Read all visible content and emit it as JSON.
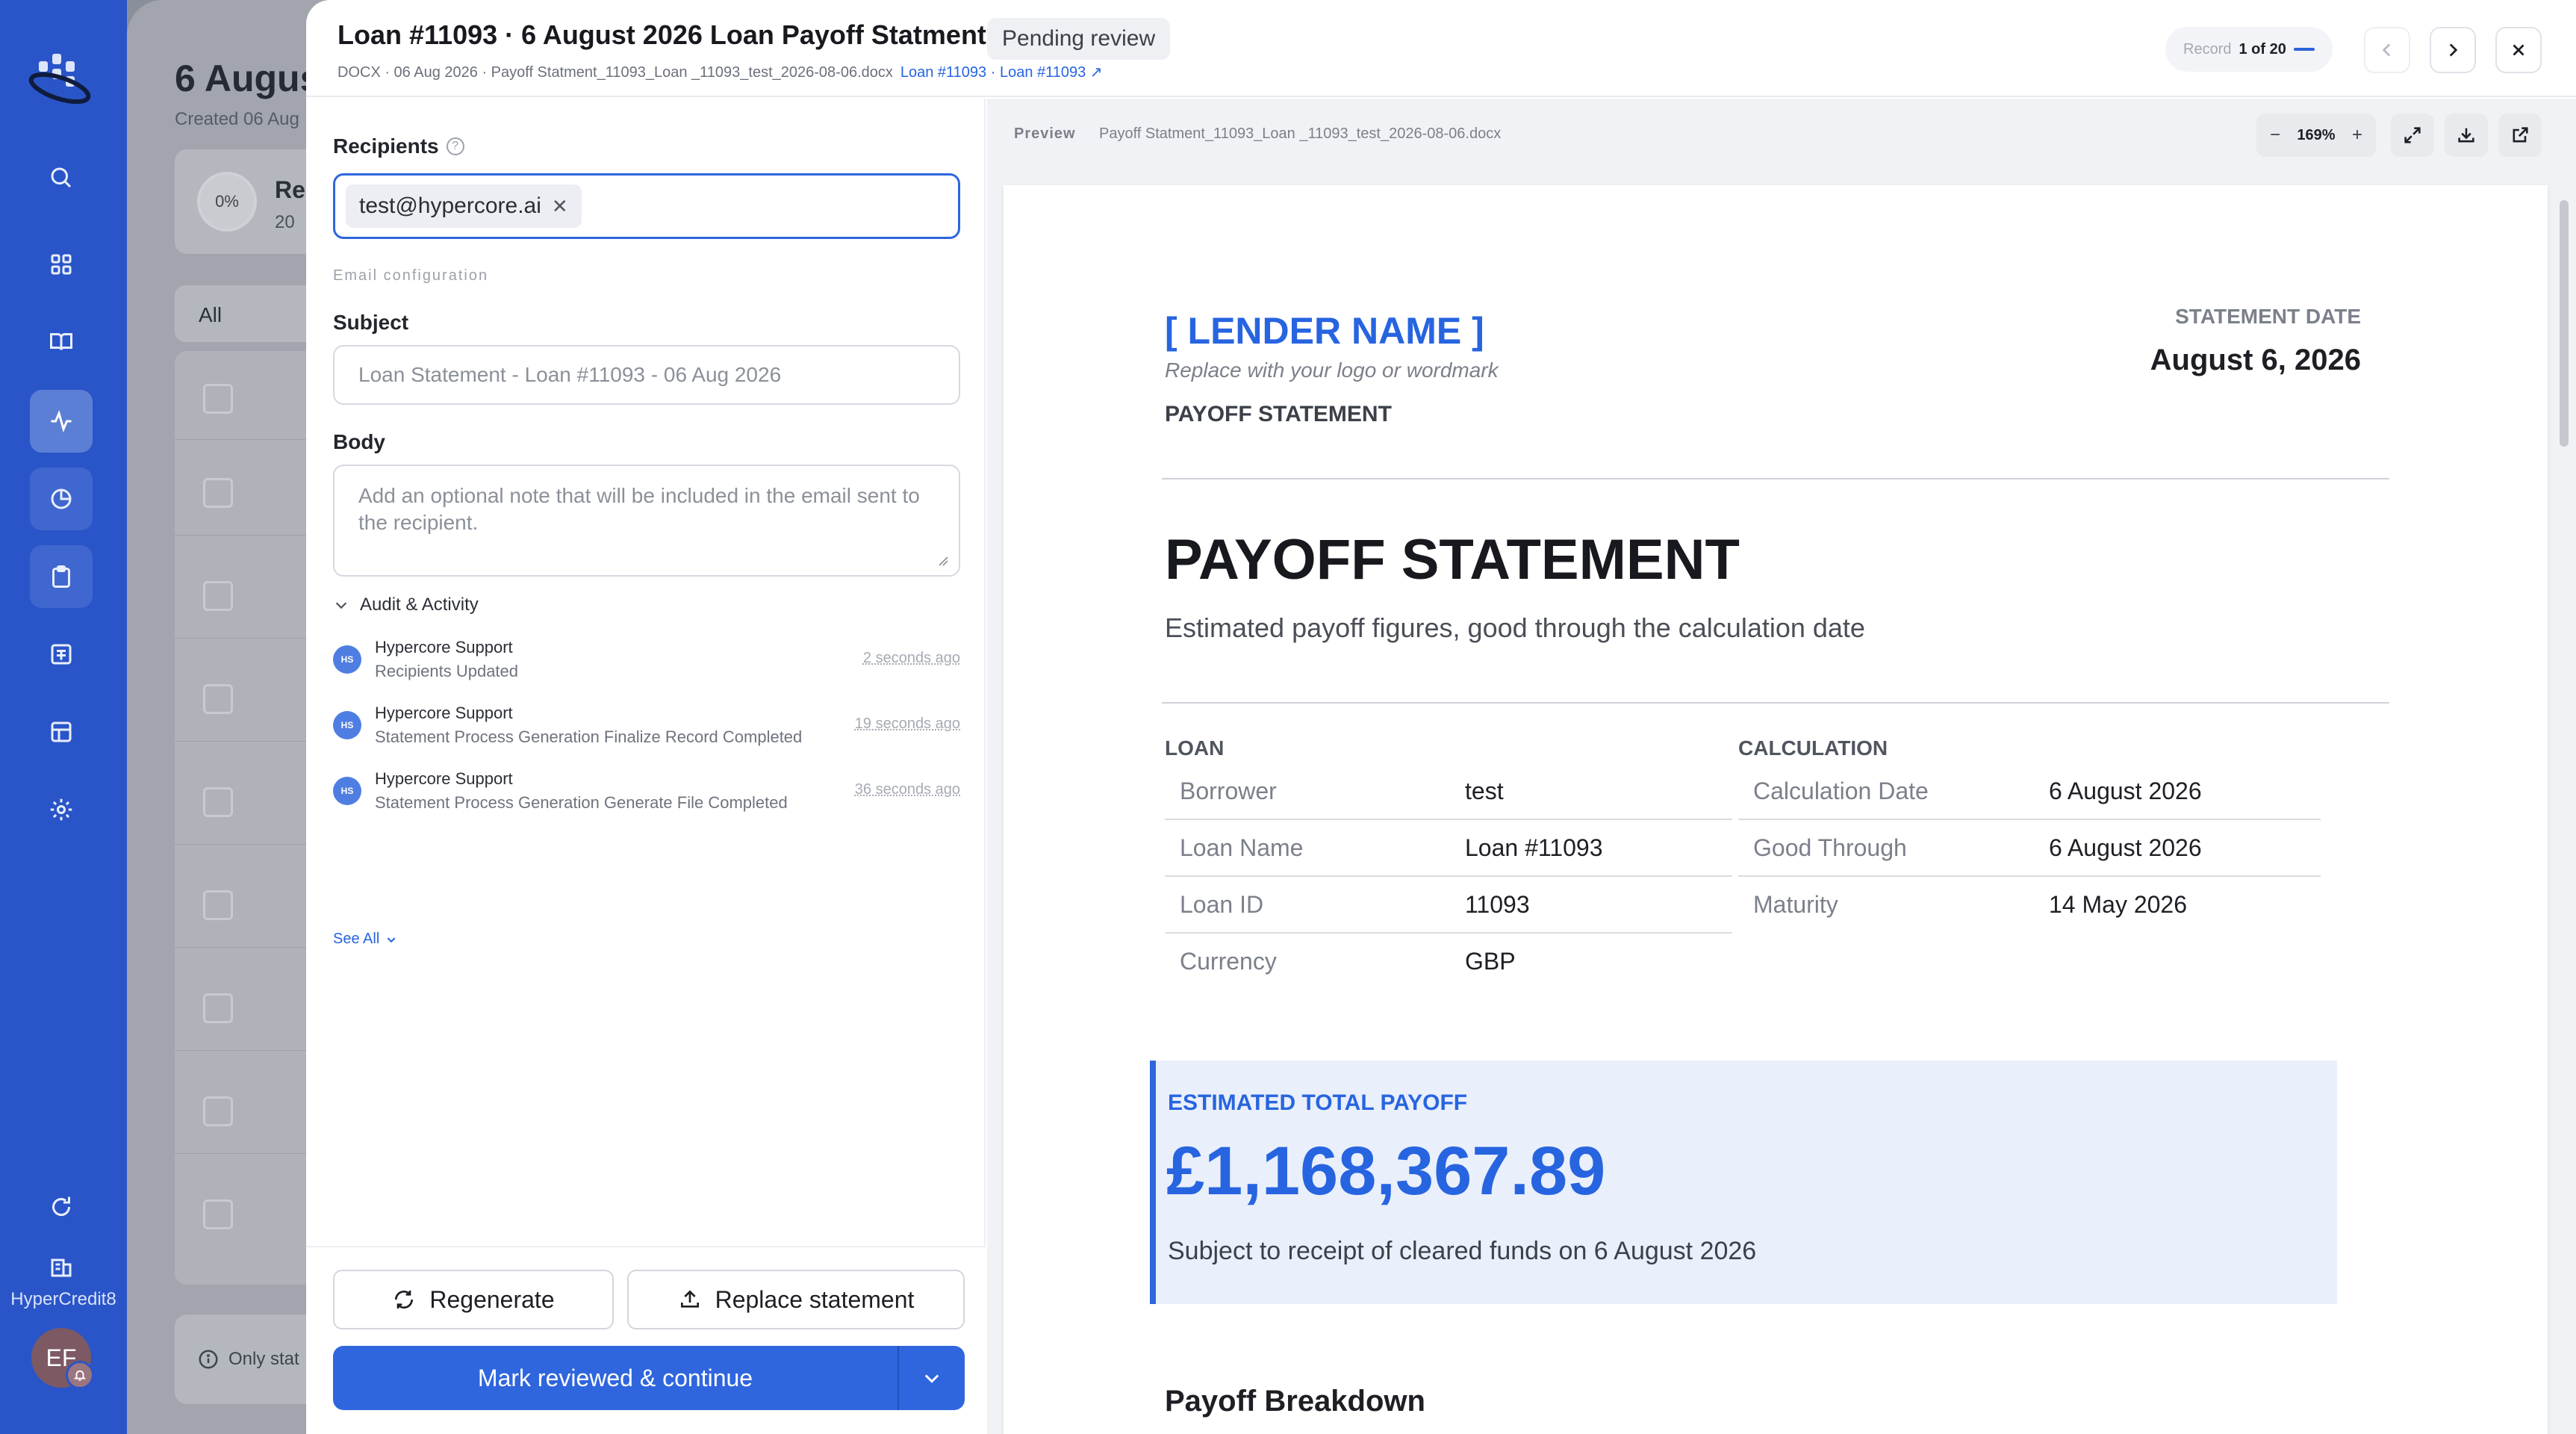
{
  "app": {
    "brand": "HyperCredit8",
    "avatar_initials": "EF"
  },
  "background_page": {
    "title": "6 Augus",
    "subtitle": "Created 06 Aug",
    "progress": "0%",
    "card_title": "Re",
    "card_count": "20",
    "tab_label": "All",
    "footer_text": "Only stat"
  },
  "modal": {
    "title": "Loan #11093 · 6 August 2026 Loan Payoff Statment",
    "status_badge": "Pending review",
    "meta": "DOCX · 06 Aug 2026 · Payoff Statment_11093_Loan _11093_test_2026-08-06.docx",
    "meta_link": "Loan #11093 · Loan #11093 ↗",
    "record_label": "Record",
    "record_value": "1 of 20"
  },
  "form": {
    "recipients_label": "Recipients",
    "recipient_chip": "test@hypercore.ai",
    "email_config_caption": "Email configuration",
    "subject_label": "Subject",
    "subject_placeholder": "Loan Statement - Loan #11093 - 06 Aug 2026",
    "body_label": "Body",
    "body_placeholder": "Add an optional note that will be included in the email sent to the recipient.",
    "audit_title": "Audit & Activity",
    "activities": [
      {
        "avatar": "HS",
        "name": "Hypercore Support",
        "desc": "Recipients Updated",
        "time": "2 seconds ago"
      },
      {
        "avatar": "HS",
        "name": "Hypercore Support",
        "desc": "Statement Process Generation Finalize Record Completed",
        "time": "19 seconds ago"
      },
      {
        "avatar": "HS",
        "name": "Hypercore Support",
        "desc": "Statement Process Generation Generate File Completed",
        "time": "36 seconds ago"
      }
    ],
    "see_all": "See All",
    "regenerate_label": "Regenerate",
    "replace_label": "Replace statement",
    "primary_label": "Mark reviewed & continue"
  },
  "preview": {
    "label": "Preview",
    "file_name": "Payoff Statment_11093_Loan _11093_test_2026-08-06.docx",
    "zoom": "169%",
    "zoom_minus": "−",
    "zoom_plus": "+"
  },
  "document": {
    "lender_name": "[ LENDER NAME ]",
    "replace_note": "Replace with your logo or wordmark",
    "doc_kind": "PAYOFF STATEMENT",
    "date_label": "STATEMENT DATE",
    "date_value": "August 6, 2026",
    "heading": "PAYOFF STATEMENT",
    "lead": "Estimated payoff figures, good through the calculation date",
    "loan_section": "LOAN",
    "loan_rows": [
      {
        "k": "Borrower",
        "v": "test"
      },
      {
        "k": "Loan Name",
        "v": "Loan #11093"
      },
      {
        "k": "Loan ID",
        "v": "11093"
      },
      {
        "k": "Currency",
        "v": "GBP"
      }
    ],
    "calc_section": "CALCULATION",
    "calc_rows": [
      {
        "k": "Calculation Date",
        "v": "6 August 2026"
      },
      {
        "k": "Good Through",
        "v": "6 August 2026"
      },
      {
        "k": "Maturity",
        "v": "14 May 2026"
      }
    ],
    "payoff_label": "ESTIMATED TOTAL PAYOFF",
    "payoff_amount": "£1,168,367.89",
    "payoff_note": "Subject to receipt of cleared funds on 6 August 2026",
    "breakdown_heading": "Payoff Breakdown"
  }
}
